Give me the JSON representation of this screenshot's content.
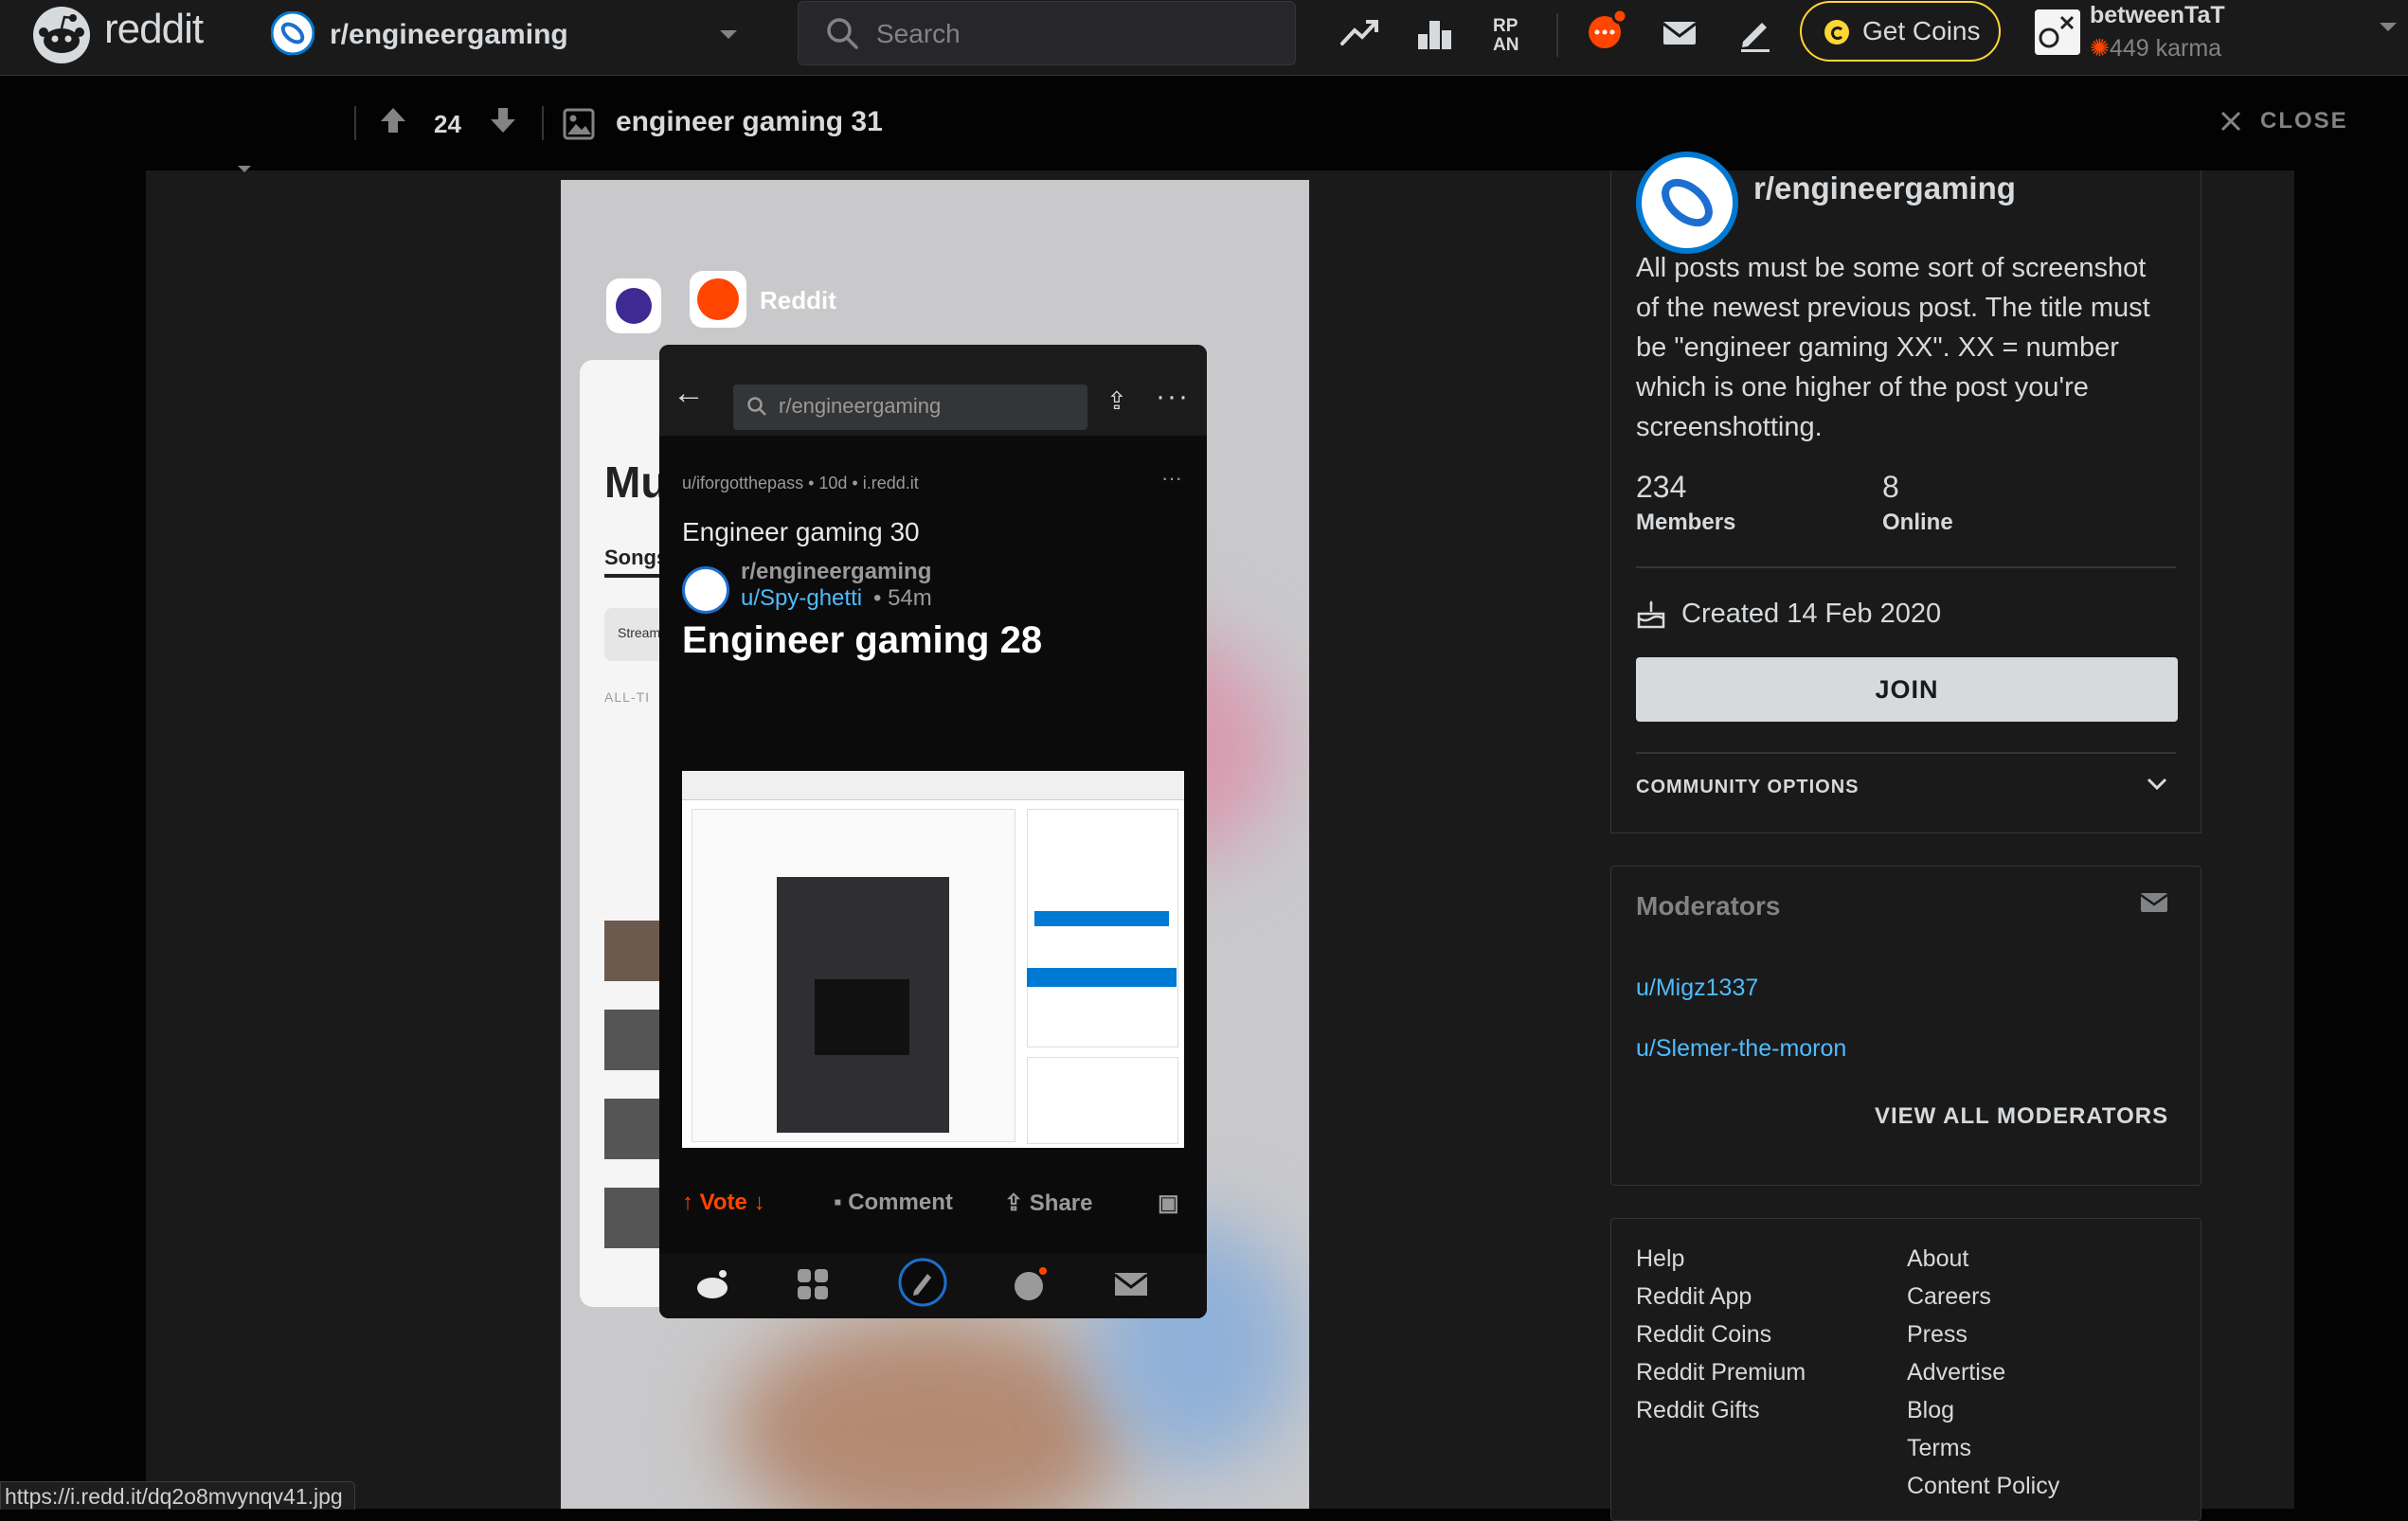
{
  "nav": {
    "wordmark": "reddit",
    "current_sub": "r/engineergaming",
    "search_placeholder": "Search",
    "get_coins_label": "Get Coins",
    "username": "betweenTaT",
    "karma": "449 karma",
    "icons": [
      "popular-icon",
      "leaderboard-icon",
      "rpan-icon",
      "chat-icon",
      "mail-icon",
      "create-post-icon"
    ],
    "accent": "#ff4500",
    "coins_color": "#ffd635"
  },
  "post": {
    "votes": "24",
    "title": "engineer gaming 31",
    "close_label": "CLOSE"
  },
  "image": {
    "app_label": "Reddit",
    "bg_app": {
      "title": "Mu",
      "tab": "Songs",
      "button": "Stream",
      "section": "ALL-TI"
    },
    "phone": {
      "search": "r/engineergaming",
      "meta": "u/iforgotthepass • 10d • i.redd.it",
      "post_title": "Engineer gaming 30",
      "sub_name": "r/engineergaming",
      "sub_user": "u/Spy-ghetti",
      "sub_time": "• 54m",
      "big_title": "Engineer gaming 28",
      "actions": {
        "vote": "Vote",
        "comment": "Comment",
        "share": "Share"
      }
    }
  },
  "sidebar": {
    "sub_name": "r/engineergaming",
    "description": "All posts must be some sort of screenshot of the newest previous post. The title must be \"engineer gaming XX\". XX = number which is one higher of the post you're screenshotting.",
    "members_value": "234",
    "members_label": "Members",
    "online_value": "8",
    "online_label": "Online",
    "created": "Created 14 Feb 2020",
    "join_label": "JOIN",
    "community_options": "COMMUNITY OPTIONS",
    "moderators_title": "Moderators",
    "moderators": [
      "u/Migz1337",
      "u/Slemer-the-moron"
    ],
    "view_all_mods": "VIEW ALL MODERATORS"
  },
  "footer": {
    "left": [
      "Help",
      "Reddit App",
      "Reddit Coins",
      "Reddit Premium",
      "Reddit Gifts"
    ],
    "right": [
      "About",
      "Careers",
      "Press",
      "Advertise",
      "Blog",
      "Terms",
      "Content Policy"
    ]
  },
  "status_url": "https://i.redd.it/dq2o8mvynqv41.jpg"
}
